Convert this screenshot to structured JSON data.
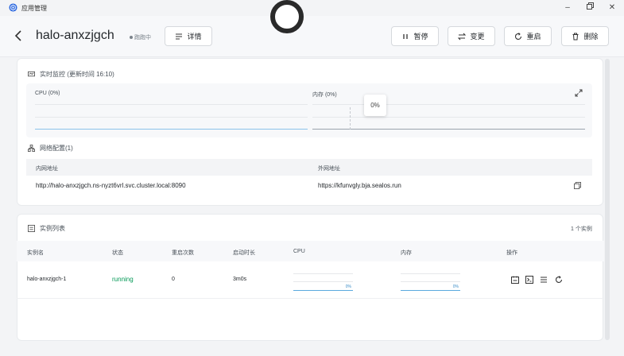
{
  "window": {
    "title": "应用管理"
  },
  "header": {
    "app_name": "halo-anxzjgch",
    "status": "跑跑中",
    "buttons": {
      "detail": "详情",
      "pause": "暂停",
      "change": "变更",
      "restart": "重启",
      "delete": "删除"
    }
  },
  "monitor": {
    "title": "实时监控 (更新时间 16:10)",
    "cpu_label": "CPU (0%)",
    "memory_label": "内存 (0%)",
    "tooltip_value": "0%"
  },
  "network": {
    "title": "网络配置(1)",
    "col_internal": "内网地址",
    "col_external": "外网地址",
    "internal_address": "http://halo-anxzjgch.ns-nyzt6vrl.svc.cluster.local:8090",
    "external_address": "https://kfunvgly.bja.sealos.run"
  },
  "instances": {
    "title": "实例列表",
    "count": "1 个实例",
    "columns": {
      "name": "实例名",
      "status": "状态",
      "restarts": "重启次数",
      "uptime": "启动时长",
      "cpu": "CPU",
      "memory": "内存",
      "actions": "操作"
    },
    "rows": [
      {
        "name": "halo-anxzjgch-1",
        "status": "running",
        "restarts": "0",
        "uptime": "3m0s",
        "cpu_pct": "0%",
        "mem_pct": "0%"
      }
    ]
  },
  "colors": {
    "running": "#039855",
    "line": "#5aa9de"
  }
}
